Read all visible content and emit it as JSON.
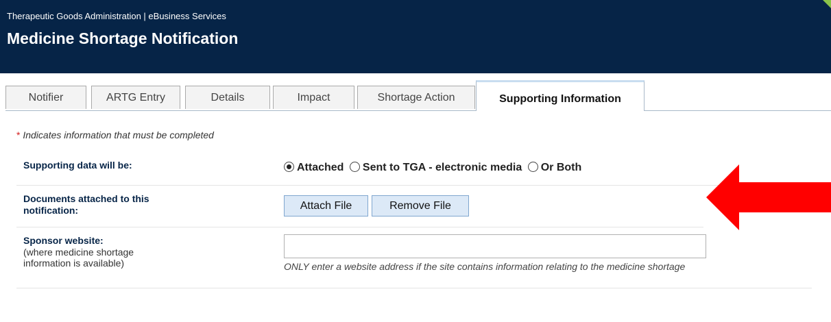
{
  "header": {
    "org": "Therapeutic Goods Administration | eBusiness Services",
    "title": "Medicine Shortage Notification"
  },
  "tabs": [
    {
      "label": "Notifier",
      "active": false
    },
    {
      "label": "ARTG Entry",
      "active": false
    },
    {
      "label": "Details",
      "active": false
    },
    {
      "label": "Impact",
      "active": false
    },
    {
      "label": "Shortage Action",
      "active": false
    },
    {
      "label": "Supporting Information",
      "active": true
    }
  ],
  "form": {
    "required_star": "*",
    "required_note": "Indicates information that must be completed",
    "supporting_data": {
      "label": "Supporting data will be:",
      "options": [
        {
          "label": "Attached",
          "checked": true
        },
        {
          "label": "Sent to TGA - electronic media",
          "checked": false
        },
        {
          "label": "Or Both",
          "checked": false
        }
      ]
    },
    "documents": {
      "label_line1": "Documents attached to this",
      "label_line2": "notification:",
      "attach_label": "Attach File",
      "remove_label": "Remove File"
    },
    "website": {
      "label": "Sponsor website:",
      "sublabel_line1": "(where medicine shortage",
      "sublabel_line2": "information is available)",
      "value": "",
      "hint": "ONLY enter a website address if the site contains information relating to the medicine shortage"
    }
  },
  "annotation": {
    "arrow_color": "#ff0000",
    "icon": "left-arrow-icon"
  }
}
